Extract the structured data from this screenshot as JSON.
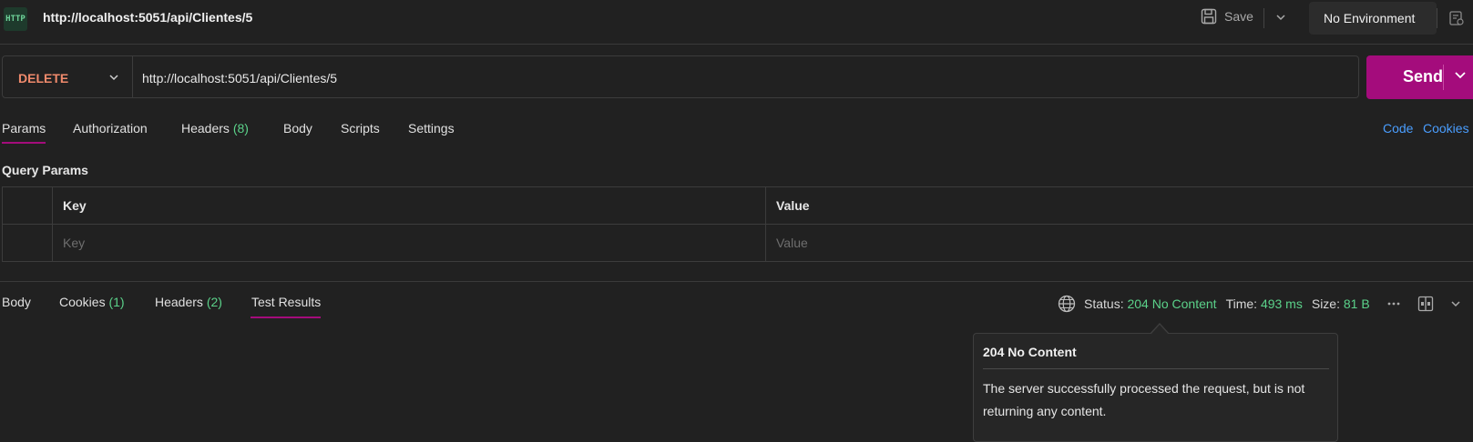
{
  "header": {
    "http_badge": "HTTP",
    "request_title": "http://localhost:5051/api/Clientes/5",
    "save_label": "Save",
    "environment": "No Environment"
  },
  "request": {
    "method": "DELETE",
    "url": "http://localhost:5051/api/Clientes/5",
    "send_label": "Send"
  },
  "request_tabs": {
    "params": "Params",
    "authorization": "Authorization",
    "headers": "Headers",
    "headers_count": "(8)",
    "body": "Body",
    "scripts": "Scripts",
    "settings": "Settings",
    "code": "Code",
    "cookies": "Cookies"
  },
  "query_params": {
    "title": "Query Params",
    "col_key": "Key",
    "col_value": "Value",
    "key_placeholder": "Key",
    "value_placeholder": "Value"
  },
  "response_tabs": {
    "body": "Body",
    "cookies": "Cookies",
    "cookies_count": "(1)",
    "headers": "Headers",
    "headers_count": "(2)",
    "test_results": "Test Results"
  },
  "status": {
    "status_label": "Status:",
    "status_value": "204 No Content",
    "time_label": "Time:",
    "time_value": "493 ms",
    "size_label": "Size:",
    "size_value": "81 B"
  },
  "tooltip": {
    "title": "204 No Content",
    "body": "The server successfully processed the request, but is not returning any content."
  },
  "colors": {
    "accent": "#a40c7c",
    "success": "#5bd28a",
    "method_delete": "#f08a6c",
    "link": "#4a9eff"
  }
}
